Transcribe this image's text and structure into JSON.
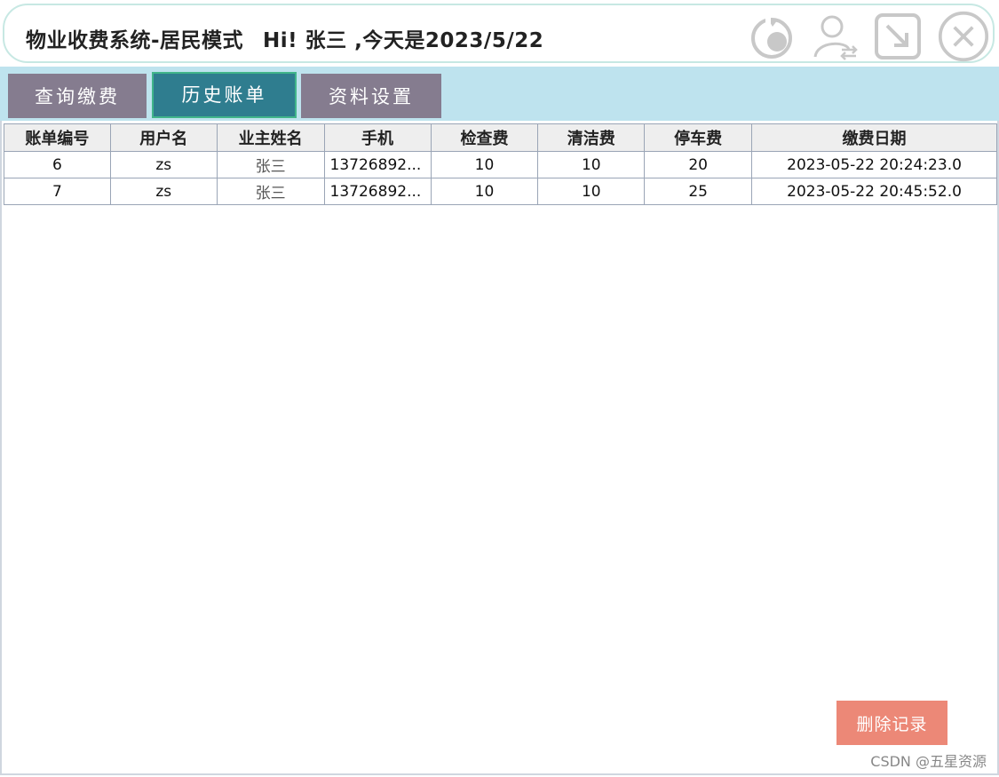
{
  "window": {
    "title": "物业收费系统-居民模式",
    "greeting": "Hi! 张三 ,今天是2023/5/22",
    "icons": [
      "refresh-icon",
      "switch-user-icon",
      "minimize-icon",
      "close-icon"
    ]
  },
  "tabs": [
    {
      "label": "查询缴费",
      "active": false
    },
    {
      "label": "历史账单",
      "active": true
    },
    {
      "label": "资料设置",
      "active": false
    }
  ],
  "table": {
    "headers": [
      "账单编号",
      "用户名",
      "业主姓名",
      "手机",
      "检查费",
      "清洁费",
      "停车费",
      "缴费日期"
    ],
    "rows": [
      [
        "6",
        "zs",
        "张三",
        "13726892...",
        "10",
        "10",
        "20",
        "2023-05-22 20:24:23.0"
      ],
      [
        "7",
        "zs",
        "张三",
        "13726892...",
        "10",
        "10",
        "25",
        "2023-05-22 20:45:52.0"
      ]
    ]
  },
  "actions": {
    "delete_label": "删除记录"
  },
  "watermark": "CSDN @五星资源",
  "colors": {
    "tab_inactive": "#857c8f",
    "tab_active": "#2f7d8f",
    "tabbar_bg": "#bee3ee",
    "delete_button": "#ec8877"
  }
}
